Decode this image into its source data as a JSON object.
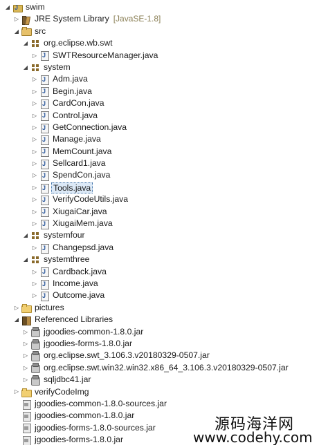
{
  "tree": [
    {
      "depth": 0,
      "twisty": "expanded",
      "icon": "project-icon",
      "label": "swim"
    },
    {
      "depth": 1,
      "twisty": "collapsed",
      "icon": "library-icon",
      "label": "JRE System Library",
      "decoration": "[JavaSE-1.8]"
    },
    {
      "depth": 1,
      "twisty": "expanded",
      "icon": "srcfolder-icon",
      "label": "src"
    },
    {
      "depth": 2,
      "twisty": "expanded",
      "icon": "package-icon",
      "label": "org.eclipse.wb.swt"
    },
    {
      "depth": 3,
      "twisty": "collapsed",
      "icon": "java-icon",
      "label": "SWTResourceManager.java"
    },
    {
      "depth": 2,
      "twisty": "expanded",
      "icon": "package-icon",
      "label": "system"
    },
    {
      "depth": 3,
      "twisty": "collapsed",
      "icon": "java-icon",
      "label": "Adm.java"
    },
    {
      "depth": 3,
      "twisty": "collapsed",
      "icon": "java-icon",
      "label": "Begin.java"
    },
    {
      "depth": 3,
      "twisty": "collapsed",
      "icon": "java-icon",
      "label": "CardCon.java"
    },
    {
      "depth": 3,
      "twisty": "collapsed",
      "icon": "java-icon",
      "label": "Control.java"
    },
    {
      "depth": 3,
      "twisty": "collapsed",
      "icon": "java-icon",
      "label": "GetConnection.java"
    },
    {
      "depth": 3,
      "twisty": "collapsed",
      "icon": "java-icon",
      "label": "Manage.java"
    },
    {
      "depth": 3,
      "twisty": "collapsed",
      "icon": "java-icon",
      "label": "MemCount.java"
    },
    {
      "depth": 3,
      "twisty": "collapsed",
      "icon": "java-icon",
      "label": "Sellcard1.java"
    },
    {
      "depth": 3,
      "twisty": "collapsed",
      "icon": "java-icon",
      "label": "SpendCon.java"
    },
    {
      "depth": 3,
      "twisty": "collapsed",
      "icon": "java-icon",
      "label": "Tools.java",
      "selected": true
    },
    {
      "depth": 3,
      "twisty": "collapsed",
      "icon": "java-icon",
      "label": "VerifyCodeUtils.java"
    },
    {
      "depth": 3,
      "twisty": "collapsed",
      "icon": "java-icon",
      "label": "XiugaiCar.java"
    },
    {
      "depth": 3,
      "twisty": "collapsed",
      "icon": "java-icon",
      "label": "XiugaiMem.java"
    },
    {
      "depth": 2,
      "twisty": "expanded",
      "icon": "package-icon",
      "label": "systemfour"
    },
    {
      "depth": 3,
      "twisty": "collapsed",
      "icon": "java-icon",
      "label": "Changepsd.java"
    },
    {
      "depth": 2,
      "twisty": "expanded",
      "icon": "package-icon",
      "label": "systemthree"
    },
    {
      "depth": 3,
      "twisty": "collapsed",
      "icon": "java-icon",
      "label": "Cardback.java"
    },
    {
      "depth": 3,
      "twisty": "collapsed",
      "icon": "java-icon",
      "label": "Income.java"
    },
    {
      "depth": 3,
      "twisty": "collapsed",
      "icon": "java-icon",
      "label": "Outcome.java"
    },
    {
      "depth": 1,
      "twisty": "collapsed",
      "icon": "folder-icon",
      "label": "pictures"
    },
    {
      "depth": 1,
      "twisty": "expanded",
      "icon": "referenced-libraries-icon",
      "label": "Referenced Libraries"
    },
    {
      "depth": 2,
      "twisty": "collapsed",
      "icon": "jar-icon",
      "label": "jgoodies-common-1.8.0.jar"
    },
    {
      "depth": 2,
      "twisty": "collapsed",
      "icon": "jar-icon",
      "label": "jgoodies-forms-1.8.0.jar"
    },
    {
      "depth": 2,
      "twisty": "collapsed",
      "icon": "jar-icon",
      "label": "org.eclipse.swt_3.106.3.v20180329-0507.jar"
    },
    {
      "depth": 2,
      "twisty": "collapsed",
      "icon": "jar-icon",
      "label": "org.eclipse.swt.win32.win32.x86_64_3.106.3.v20180329-0507.jar"
    },
    {
      "depth": 2,
      "twisty": "collapsed",
      "icon": "jar-icon",
      "label": "sqljdbc41.jar"
    },
    {
      "depth": 1,
      "twisty": "collapsed",
      "icon": "folder-icon",
      "label": "verifyCodeImg"
    },
    {
      "depth": 1,
      "twisty": "none",
      "icon": "jar-file-icon",
      "label": "jgoodies-common-1.8.0-sources.jar"
    },
    {
      "depth": 1,
      "twisty": "none",
      "icon": "jar-file-icon",
      "label": "jgoodies-common-1.8.0.jar"
    },
    {
      "depth": 1,
      "twisty": "none",
      "icon": "jar-file-icon",
      "label": "jgoodies-forms-1.8.0-sources.jar"
    },
    {
      "depth": 1,
      "twisty": "none",
      "icon": "jar-file-icon",
      "label": "jgoodies-forms-1.8.0.jar"
    }
  ],
  "watermark": {
    "text_cn": "源码海洋网",
    "url": "www.codehy.com"
  },
  "colors": {
    "selection_bg": "#dce9f7",
    "selection_border": "#3a6ea5",
    "decoration_text": "#8a7f55"
  }
}
